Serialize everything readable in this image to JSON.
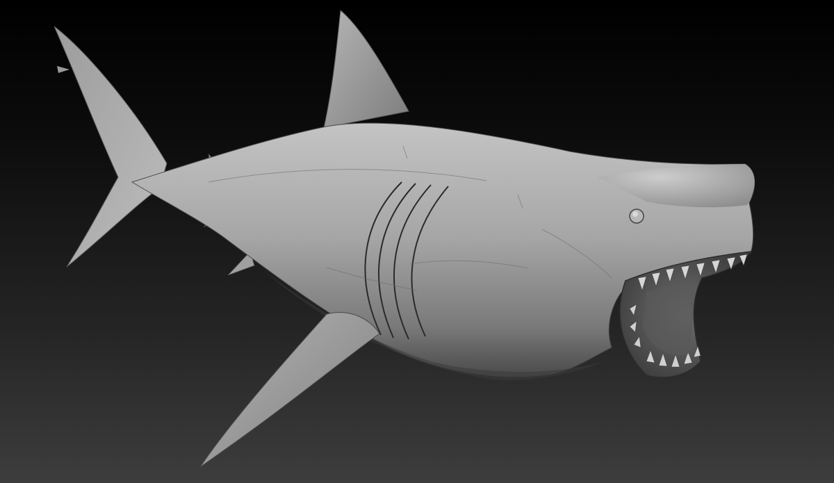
{
  "scene": {
    "subject_icon": "shark-sculpt-icon",
    "colors": {
      "background_top": "#000000",
      "background_bottom": "#3d3d3d",
      "material_light": "#bdbdbd",
      "material_mid": "#8f8f8f",
      "material_dark": "#3a3a3a"
    }
  }
}
